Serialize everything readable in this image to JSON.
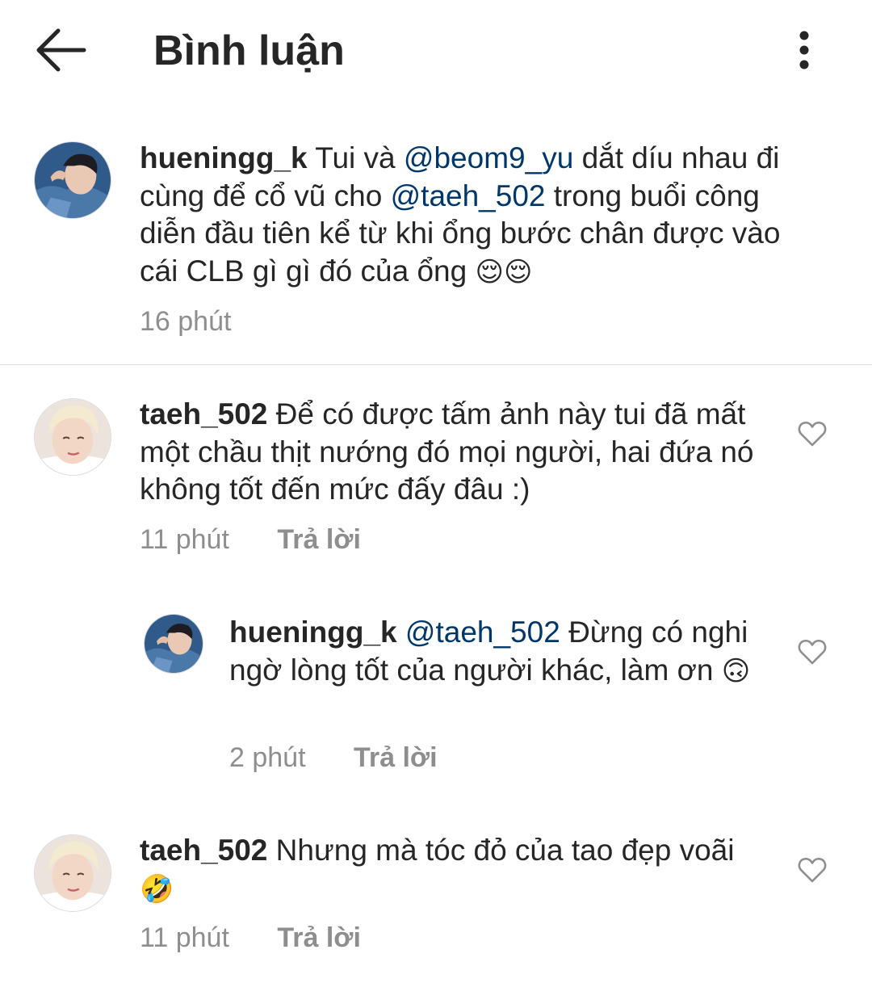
{
  "header": {
    "title": "Bình luận",
    "back_icon": "arrow-left-icon",
    "more_icon": "more-vertical-icon"
  },
  "caption": {
    "username": "hueningg_k",
    "text_1": "Tui và",
    "mention_1": "@beom9_yu",
    "text_2": "dắt díu nhau đi cùng để cổ vũ cho",
    "mention_2": "@taeh_502",
    "text_3": "trong buổi công diễn đầu tiên kể từ khi ổng bước chân được vào cái CLB gì gì đó của ổng",
    "emoji": "😌😌",
    "time": "16 phút"
  },
  "comments": [
    {
      "username": "taeh_502",
      "text": "Để có được tấm ảnh này tui đã mất một chầu thịt nướng đó mọi người, hai đứa nó không tốt đến mức đấy đâu :)",
      "time": "11 phút",
      "reply_label": "Trả lời"
    },
    {
      "username": "hueningg_k",
      "mention": "@taeh_502",
      "text": "Đừng có nghi ngờ lòng tốt của người khác, làm ơn",
      "emoji": "🙃",
      "time": "2 phút",
      "reply_label": "Trả lời"
    },
    {
      "username": "taeh_502",
      "text": "Nhưng mà tóc đỏ của tao đẹp voãi",
      "emoji": "🤣",
      "time": "11 phút",
      "reply_label": "Trả lời"
    }
  ],
  "colors": {
    "text": "#262626",
    "mention": "#00376b",
    "secondary": "#8e8e8e",
    "divider": "#dbdbdb"
  }
}
